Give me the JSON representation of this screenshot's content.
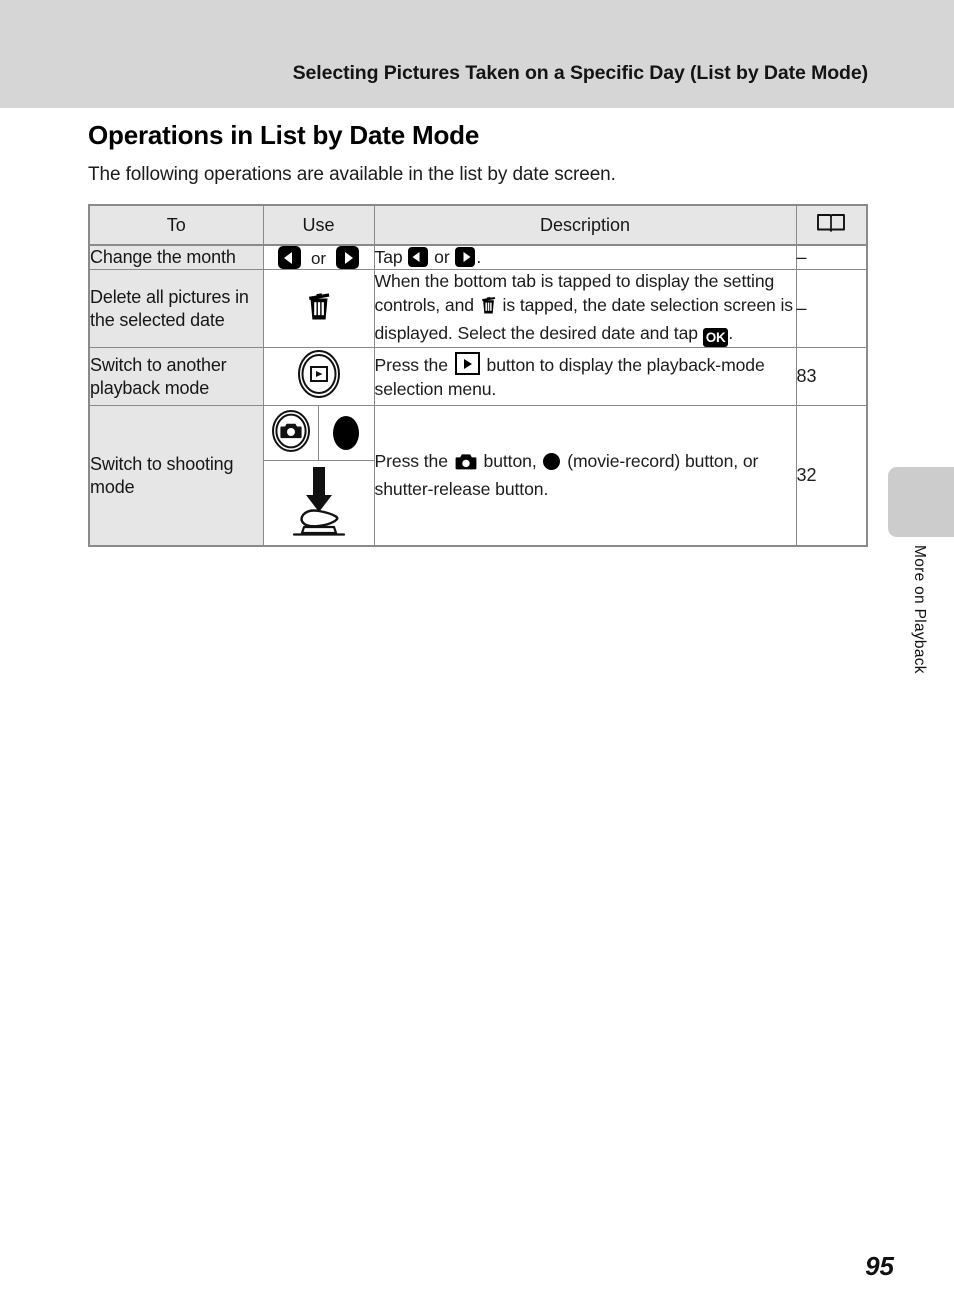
{
  "header": {
    "running_title": "Selecting Pictures Taken on a Specific Day (List by Date Mode)"
  },
  "section": {
    "title": "Operations in List by Date Mode",
    "intro": "The following operations are available in the list by date screen."
  },
  "table": {
    "columns": {
      "to": "To",
      "use": "Use",
      "description": "Description",
      "reference": "book-icon"
    },
    "rows": [
      {
        "to": "Change the month",
        "use_icons": [
          "arrow-left-icon",
          "or",
          "arrow-right-icon"
        ],
        "use_or_label": "or",
        "description_prefix": "Tap ",
        "description_mid": " or ",
        "description_suffix": ".",
        "reference": "–"
      },
      {
        "to": "Delete all pictures in the selected date",
        "use_icons": [
          "trash-icon"
        ],
        "description_part1": "When the bottom tab is tapped to display the setting controls, and ",
        "description_part2": " is tapped, the date selection screen is displayed. Select the desired date and tap ",
        "description_part3": ".",
        "ok_label": "OK",
        "reference": "–"
      },
      {
        "to": "Switch to another playback mode",
        "use_icons": [
          "playback-mode-ring-icon"
        ],
        "description_part1": "Press the ",
        "description_part2": " button to display the playback-mode selection menu.",
        "reference": "83"
      },
      {
        "to": "Switch to shooting mode",
        "use_icons": [
          "camera-mode-ring-icon",
          "movie-record-oval-icon",
          "shutter-press-icon"
        ],
        "description_part1": "Press the ",
        "description_part2": " button, ",
        "description_part3": " (movie-record) button, or shutter-release button.",
        "reference": "32"
      }
    ]
  },
  "side_tab": {
    "label": "More on Playback"
  },
  "footer": {
    "page_number": "95"
  }
}
